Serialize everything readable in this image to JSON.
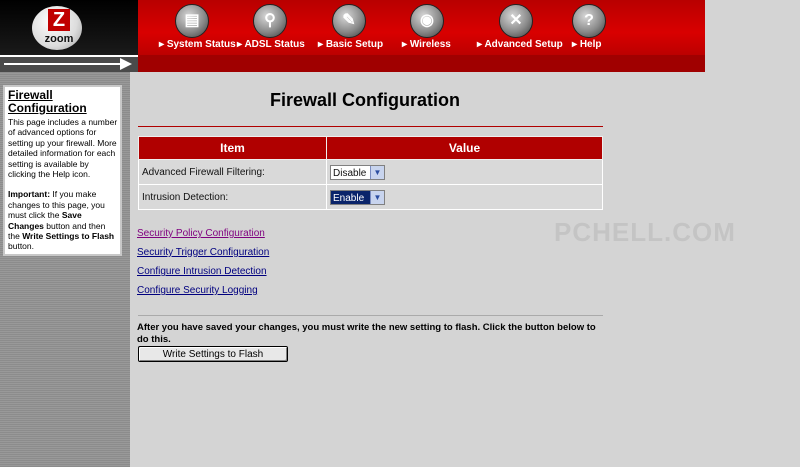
{
  "logo": {
    "text": "zoom",
    "letter": "Z"
  },
  "nav": [
    {
      "label": "System Status",
      "icon": "system-status-icon",
      "glyph": "▤"
    },
    {
      "label": "ADSL Status",
      "icon": "magnifier-icon",
      "glyph": "⚲"
    },
    {
      "label": "Basic Setup",
      "icon": "plug-icon",
      "glyph": "✎"
    },
    {
      "label": "Wireless",
      "icon": "antenna-icon",
      "glyph": "◉"
    },
    {
      "label": "Advanced Setup",
      "icon": "wrench-icon",
      "glyph": "✕"
    },
    {
      "label": "Help",
      "icon": "help-icon",
      "glyph": "?"
    }
  ],
  "sidebar": {
    "title": "Firewall Configuration",
    "body": "This page includes a number of advanced options for setting up your firewall. More detailed information for each setting is available by clicking the Help icon.",
    "important_label": "Important:",
    "important_text_1": " If you make changes to this page, you must click the ",
    "important_bold_1": "Save Changes",
    "important_text_2": " button and then the ",
    "important_bold_2": "Write Settings to Flash",
    "important_text_3": " button."
  },
  "main": {
    "title": "Firewall Configuration",
    "table": {
      "headers": [
        "Item",
        "Value"
      ],
      "rows": [
        {
          "label": "Advanced Firewall Filtering:",
          "value": "Disable"
        },
        {
          "label": "Intrusion Detection:",
          "value": "Enable"
        }
      ]
    },
    "links": [
      "Security Policy Configuration",
      "Security Trigger Configuration",
      "Configure Intrusion Detection",
      "Configure Security Logging"
    ],
    "flash_text": "After you have saved your changes, you must write the new setting to flash. Click the button below to do this.",
    "flash_button": "Write Settings to Flash"
  },
  "watermark": "PCHELL.COM",
  "colors": {
    "brand_red": "#b00000",
    "link": "#00007f",
    "link_visited": "#7f007f"
  }
}
